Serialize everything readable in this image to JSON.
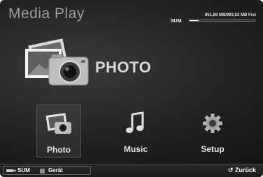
{
  "header": {
    "title": "Media Play",
    "storage": {
      "device": "SUM",
      "summary": "851,86 MB/993,02 MB Frei",
      "used_fraction": 0.14
    }
  },
  "hero": {
    "label": "PHOTO",
    "icon": "photo-camera-icon"
  },
  "menu": {
    "items": [
      {
        "label": "Photo",
        "icon": "photo-camera-icon",
        "selected": true
      },
      {
        "label": "Music",
        "icon": "music-note-icon",
        "selected": false
      },
      {
        "label": "Setup",
        "icon": "gear-icon",
        "selected": false
      }
    ]
  },
  "footer": {
    "items": [
      {
        "label": "SUM",
        "icon": "usb-stick-icon"
      },
      {
        "label": "Gerät",
        "icon": "device-square-icon"
      }
    ],
    "back_label": "Zurück",
    "back_icon": "return-arrow-icon"
  },
  "colors": {
    "background": "#1d1d1d",
    "text": "#e6e6e6",
    "title": "#9d9d9d"
  }
}
